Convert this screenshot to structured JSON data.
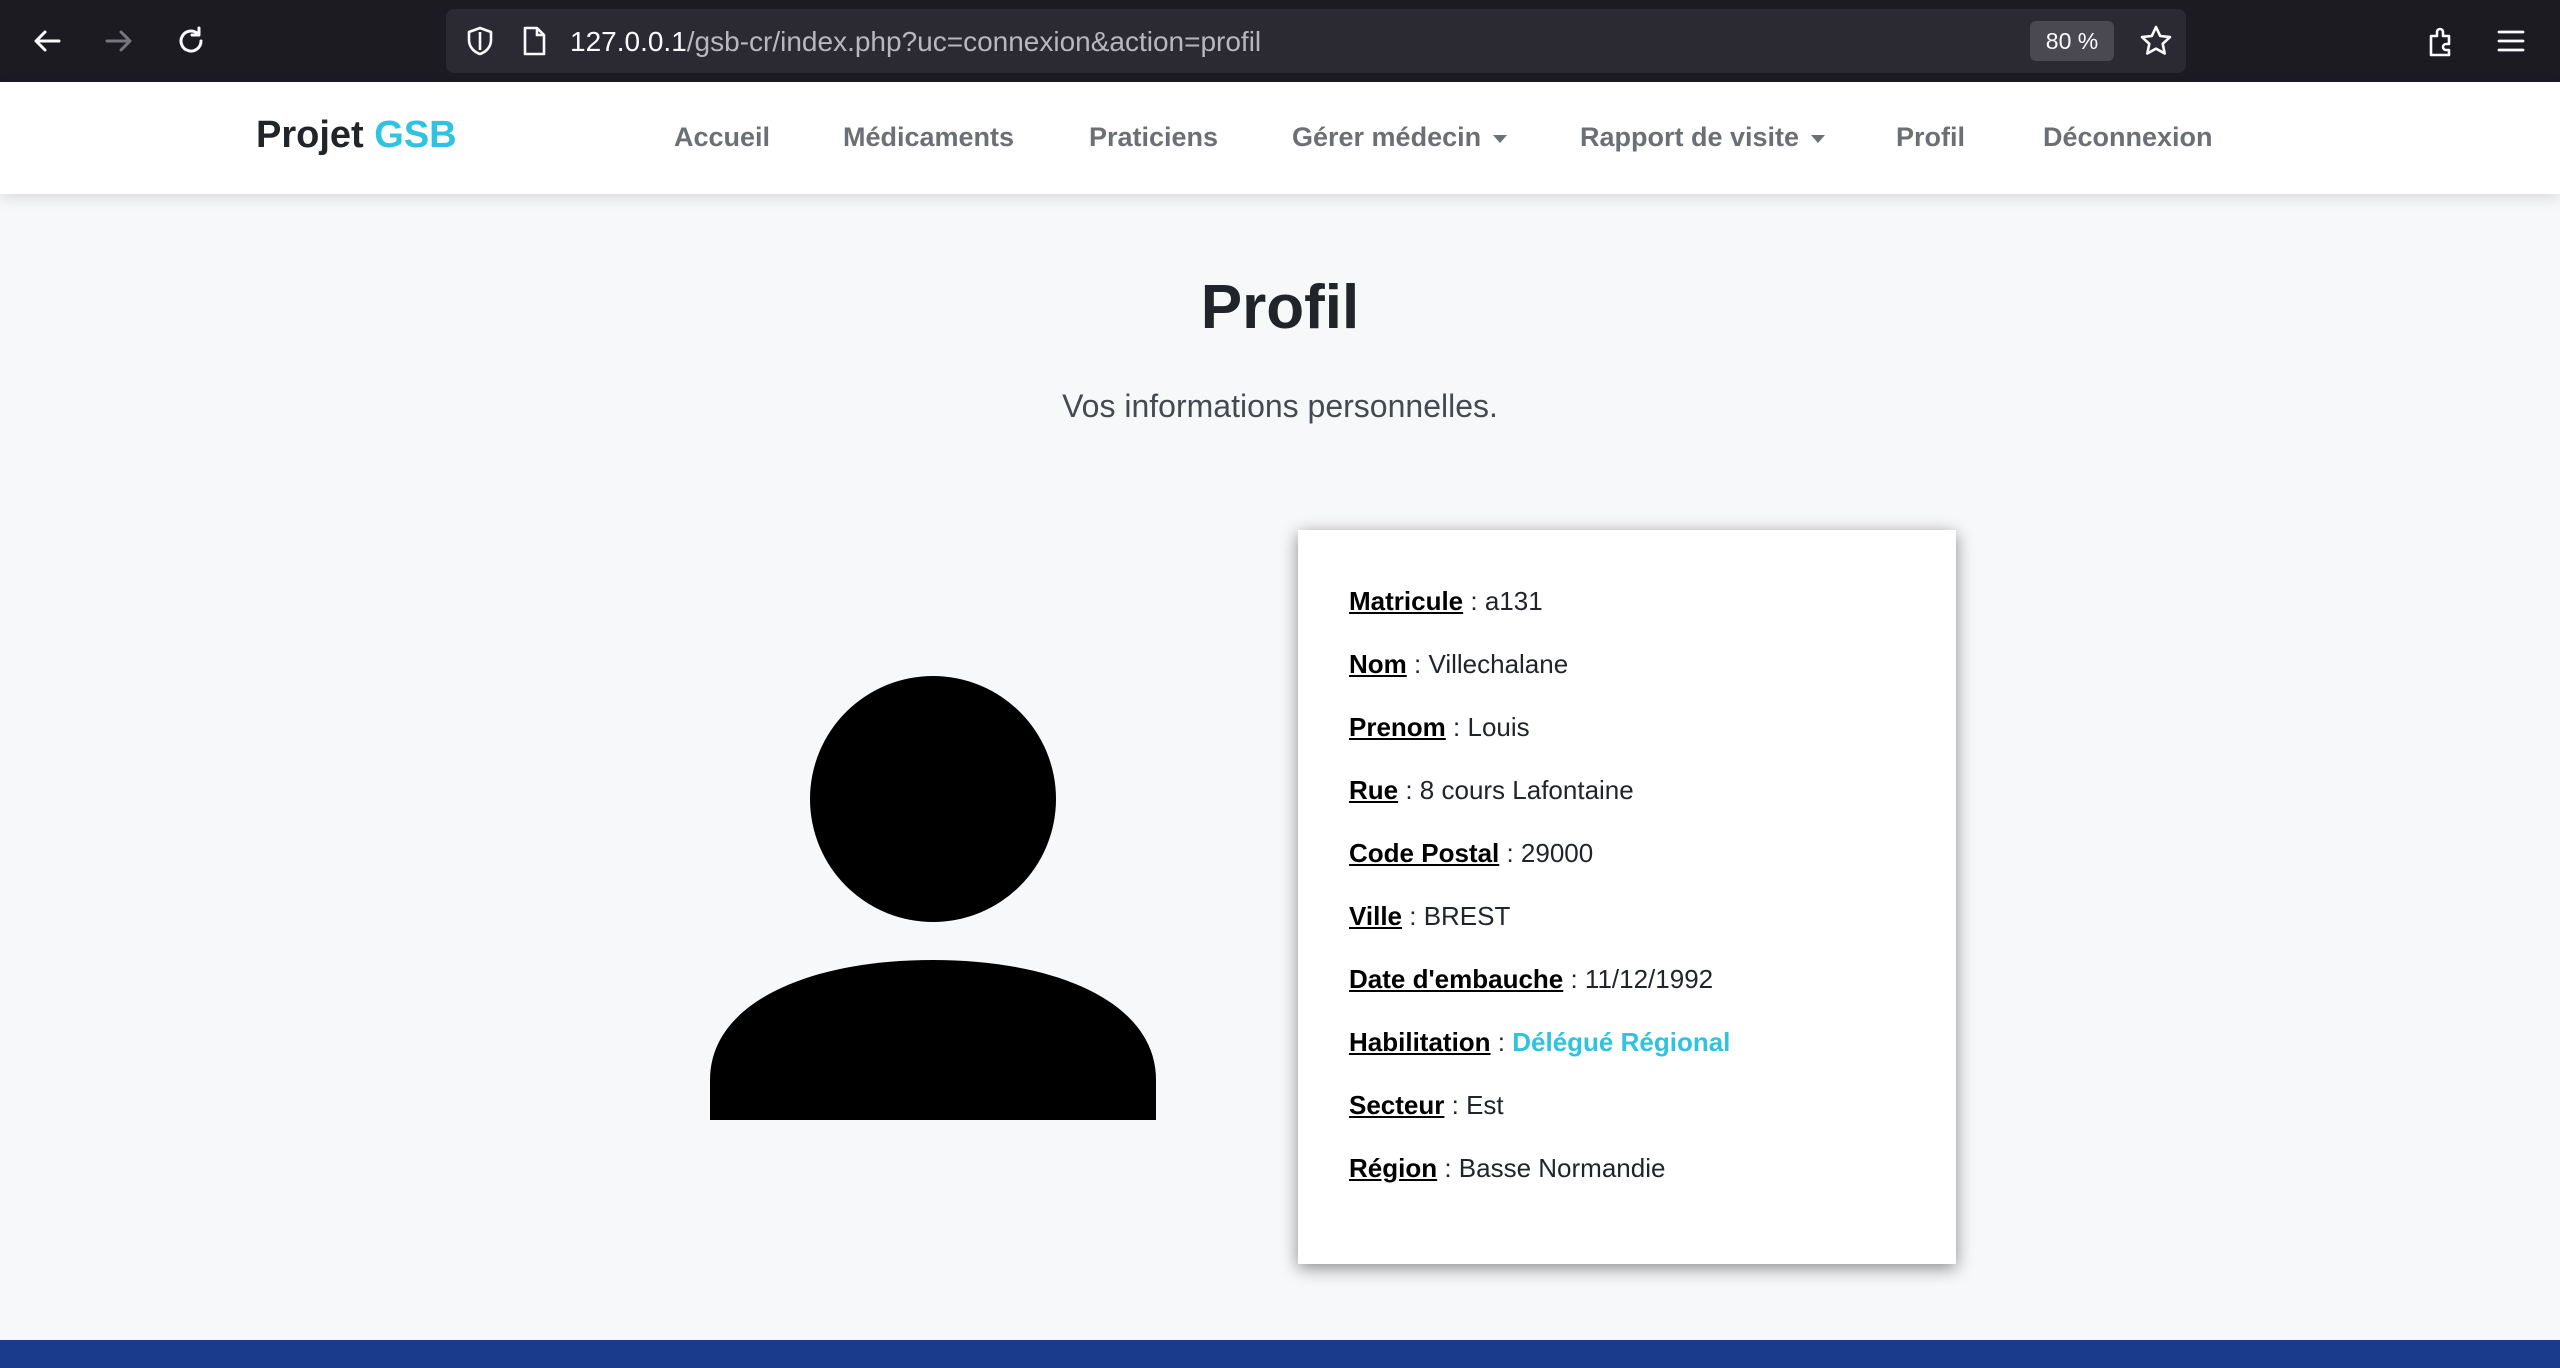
{
  "browser": {
    "url_host": "127.0.0.1",
    "url_path": "/gsb-cr/index.php?uc=connexion&action=profil",
    "zoom": "80 %",
    "icons": [
      "back-icon",
      "forward-icon",
      "reload-icon",
      "shield-icon",
      "page-icon",
      "star-icon",
      "extensions-icon",
      "menu-icon"
    ]
  },
  "nav": {
    "brand_main": "Projet",
    "brand_accent": "GSB",
    "items": [
      "Accueil",
      "Médicaments",
      "Praticiens",
      "Gérer médecin",
      "Rapport de visite",
      "Profil",
      "Déconnexion"
    ]
  },
  "page": {
    "title": "Profil",
    "subtitle": "Vos informations personnelles."
  },
  "profile": {
    "fields": [
      {
        "label": "Matricule",
        "sep": " : ",
        "value": "a131"
      },
      {
        "label": "Nom",
        "sep": " : ",
        "value": "Villechalane"
      },
      {
        "label": "Prenom",
        "sep": " : ",
        "value": "Louis"
      },
      {
        "label": "Rue",
        "sep": " : ",
        "value": "8 cours Lafontaine"
      },
      {
        "label": "Code Postal",
        "sep": " : ",
        "value": "29000"
      },
      {
        "label": "Ville",
        "sep": " : ",
        "value": "BREST"
      },
      {
        "label": "Date d'embauche",
        "sep": " : ",
        "value": "11/12/1992"
      },
      {
        "label": "Habilitation",
        "sep": " : ",
        "value": "Délégué Régional"
      },
      {
        "label": "Secteur",
        "sep": " : ",
        "value": "Est"
      },
      {
        "label": "Région",
        "sep": " : ",
        "value": "Basse Normandie"
      }
    ]
  },
  "colors": {
    "accent": "#2ec3e0",
    "browser_bg": "#1c1b22",
    "footer": "#1a3a8c"
  }
}
